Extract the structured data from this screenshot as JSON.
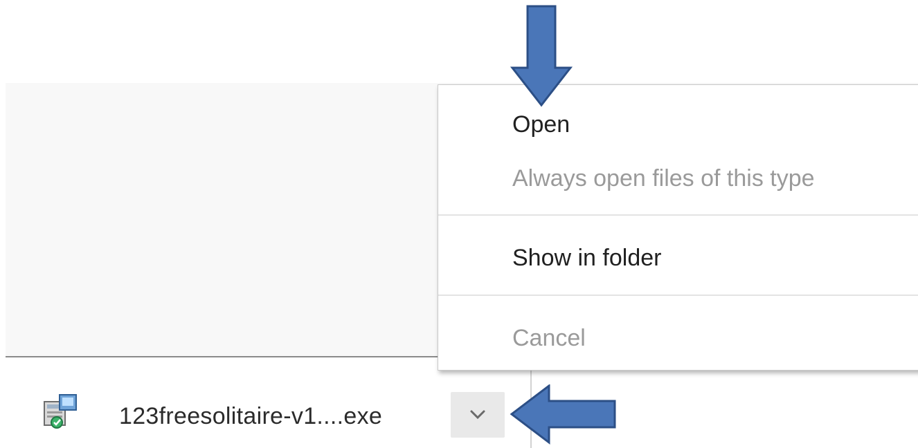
{
  "download": {
    "file_name": "123freesolitaire-v1....exe",
    "file_icon": "installer-icon",
    "menu_button_icon": "chevron-down-icon"
  },
  "context_menu": {
    "items": [
      {
        "label": "Open",
        "enabled": true
      },
      {
        "label": "Always open files of this type",
        "enabled": false
      },
      {
        "label": "Show in folder",
        "enabled": true
      },
      {
        "label": "Cancel",
        "enabled": false
      }
    ]
  },
  "annotations": {
    "arrow_color": "#4a76b8",
    "arrow_outline": "#2c4f86",
    "arrows": [
      "down-arrow-pointing-to-open",
      "left-arrow-pointing-to-menu-button"
    ]
  },
  "colors": {
    "menu_text_enabled": "#202020",
    "menu_text_disabled": "#9a9a9a",
    "shelf_background": "#ffffff",
    "page_background": "#f8f8f8"
  }
}
